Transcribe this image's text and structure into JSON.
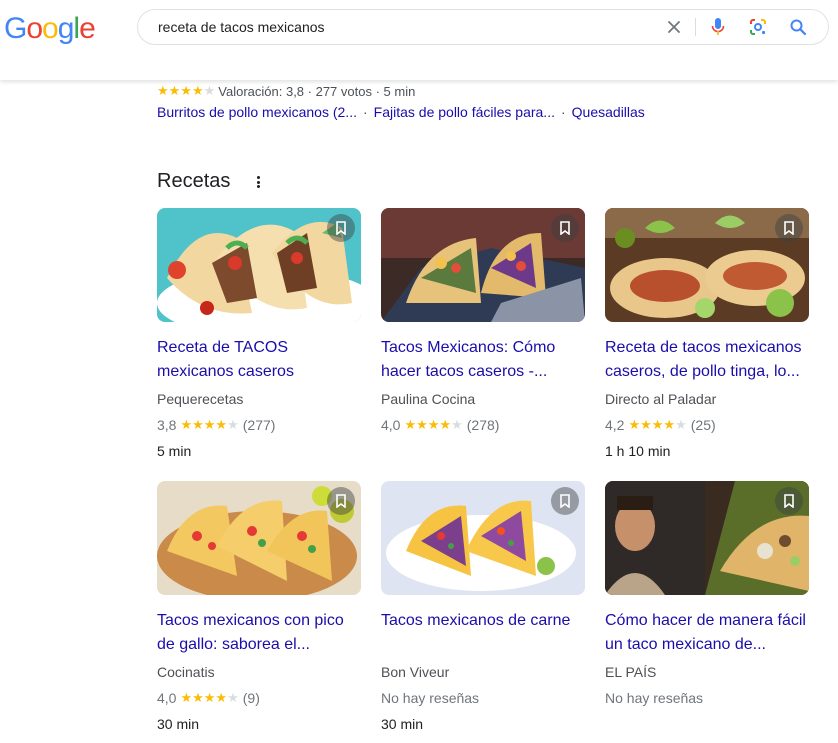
{
  "header": {
    "logo_letters": [
      "G",
      "o",
      "o",
      "g",
      "l",
      "e"
    ],
    "logo_colors": [
      "#4285f4",
      "#ea4335",
      "#fbbc05",
      "#4285f4",
      "#34a853",
      "#ea4335"
    ],
    "search_value": "receta de tacos mexicanos",
    "icons": [
      "close-icon",
      "mic-icon",
      "lens-icon",
      "search-icon"
    ]
  },
  "snippet": {
    "rating_text": "Valoración: 3,8 · 277 votos · 5 min",
    "stars_filled": 4,
    "related": [
      "Burritos de pollo mexicanos (2...",
      "Fajitas de pollo fáciles para...",
      "Quesadillas"
    ],
    "separator": "·"
  },
  "section": {
    "title": "Recetas"
  },
  "cards": [
    {
      "title": "Receta de TACOS mexicanos caseros",
      "source": "Pequerecetas",
      "rating": "3,8",
      "stars": 4,
      "votes": "(277)",
      "time": "5 min",
      "no_reviews": ""
    },
    {
      "title": "Tacos Mexicanos: Cómo hacer tacos caseros -...",
      "source": "Paulina Cocina",
      "rating": "4,0",
      "stars": 4,
      "votes": "(278)",
      "time": "",
      "no_reviews": ""
    },
    {
      "title": "Receta de tacos mexicanos caseros, de pollo tinga, lo...",
      "source": "Directo al Paladar",
      "rating": "4,2",
      "stars": 4,
      "votes": "(25)",
      "time": "1 h 10 min",
      "no_reviews": ""
    },
    {
      "title": "Tacos mexicanos con pico de gallo: saborea el...",
      "source": "Cocinatis",
      "rating": "4,0",
      "stars": 4,
      "votes": "(9)",
      "time": "30 min",
      "no_reviews": ""
    },
    {
      "title": "Tacos mexicanos de carne",
      "source": "Bon Viveur",
      "rating": "",
      "stars": 0,
      "votes": "",
      "time": "30 min",
      "no_reviews": "No hay reseñas"
    },
    {
      "title": "Cómo hacer de manera fácil un taco mexicano de...",
      "source": "EL PAÍS",
      "rating": "",
      "stars": 0,
      "votes": "",
      "time": "",
      "no_reviews": "No hay reseñas"
    }
  ],
  "colors": {
    "link": "#1a0dab",
    "star": "#fbbc04"
  }
}
